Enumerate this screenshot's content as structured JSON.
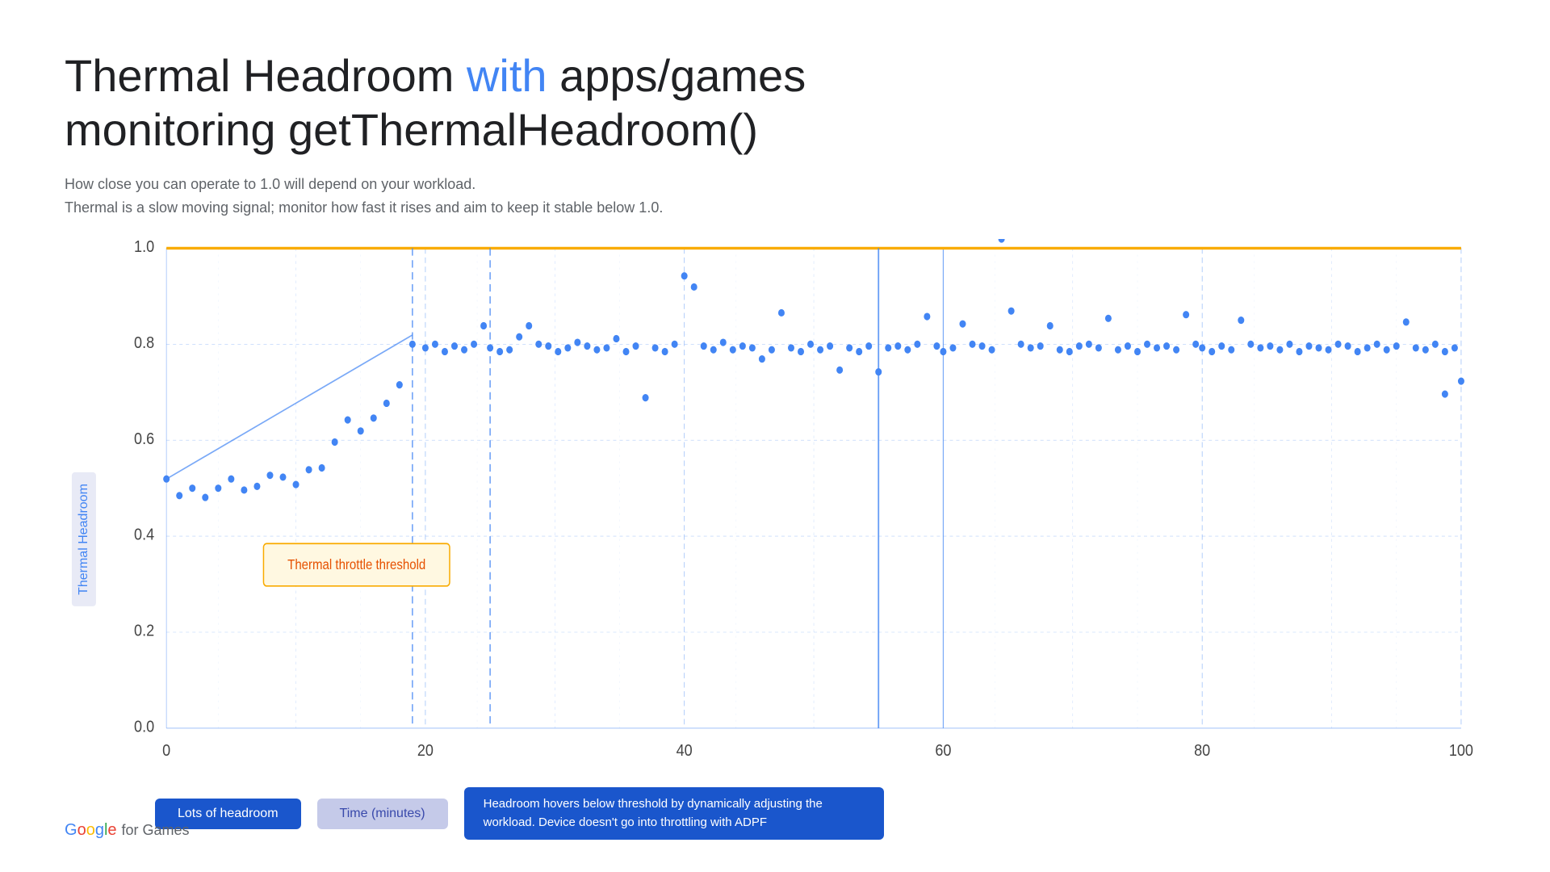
{
  "title": {
    "part1": "Thermal Headroom ",
    "highlight": "with",
    "part2": " apps/games",
    "line2": "monitoring getThermalHeadroom()"
  },
  "subtitle": {
    "line1": "How close you can operate to 1.0 will depend on your workload.",
    "line2": "Thermal is a slow moving signal; monitor how fast it rises and aim to keep it stable below 1.0."
  },
  "chart": {
    "y_axis_label": "Thermal Headroom",
    "x_axis_label": "Time (minutes)",
    "y_ticks": [
      "0.0",
      "0.2",
      "0.4",
      "0.6",
      "0.8",
      "1.0"
    ],
    "x_ticks": [
      "0",
      "20",
      "40",
      "60",
      "80",
      "100"
    ],
    "threshold_label": "Thermal throttle threshold",
    "threshold_value": 1.0
  },
  "bottom_labels": {
    "left": "Lots of headroom",
    "center": "Time (minutes)",
    "right": "Headroom hovers below threshold by dynamically adjusting the workload. Device doesn't go into throttling with ADPF"
  },
  "google_logo": {
    "google": "Google",
    "for_games": "for Games"
  }
}
